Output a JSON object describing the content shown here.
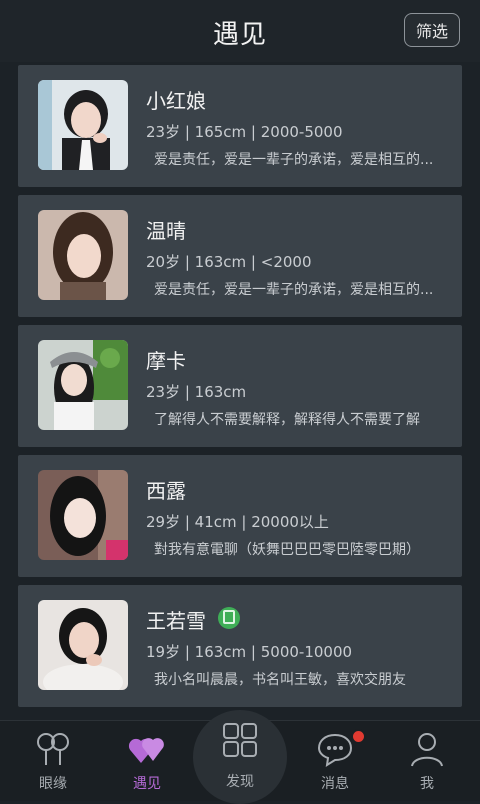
{
  "header": {
    "title": "遇见",
    "filter_label": "筛选"
  },
  "cards": [
    {
      "name": "小红娘",
      "meta": "23岁 | 165cm | 2000-5000",
      "desc": "爱是责任，爱是一辈子的承诺，爱是相互的..."
    },
    {
      "name": "温晴",
      "meta": "20岁 | 163cm | <2000",
      "desc": "爱是责任，爱是一辈子的承诺，爱是相互的..."
    },
    {
      "name": "摩卡",
      "meta": "23岁 | 163cm",
      "desc": "了解得人不需要解释，解释得人不需要了解"
    },
    {
      "name": "西露",
      "meta": "29岁 | 41cm | 20000以上",
      "desc": "對我有意電聊（妖舞巴巴巴零巴陸零巴期）"
    },
    {
      "name": "王若雪",
      "meta": "19岁 | 163cm | 5000-10000",
      "desc": "我小名叫晨晨，书名叫王敏，喜欢交朋友"
    }
  ],
  "tabs": [
    {
      "label": "眼缘",
      "icon": "eye-contact-icon"
    },
    {
      "label": "遇见",
      "icon": "hearts-icon"
    },
    {
      "label": "发现",
      "icon": "grid-icon"
    },
    {
      "label": "消息",
      "icon": "chat-bubble-icon"
    },
    {
      "label": "我",
      "icon": "person-icon"
    }
  ],
  "colors": {
    "accent": "#b56ad6",
    "card": "#3a4249",
    "badge": "#3fae57",
    "notification": "#e03a31"
  }
}
